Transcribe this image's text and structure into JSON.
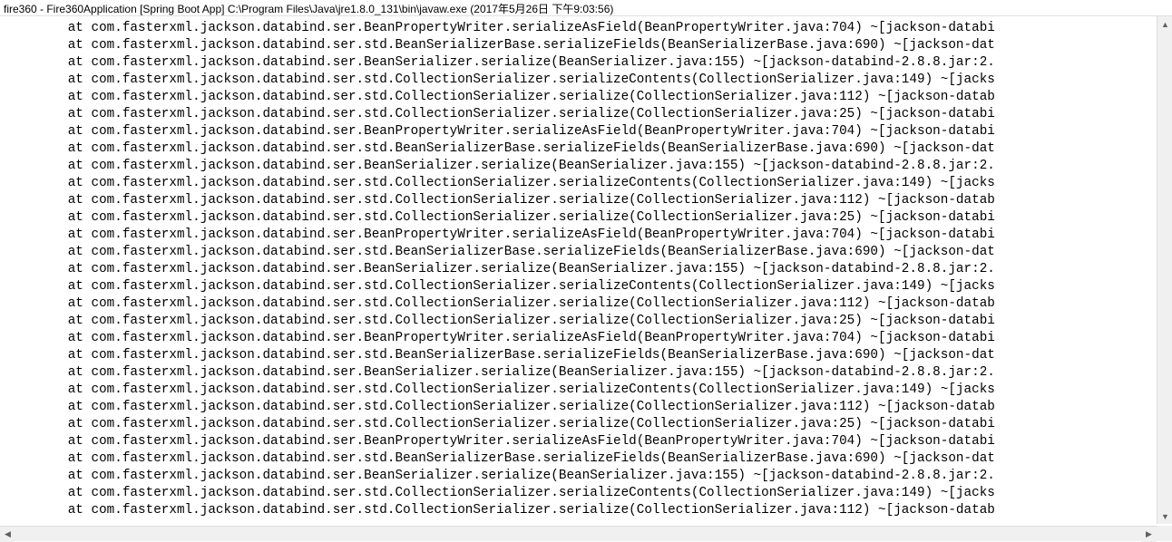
{
  "title": "fire360 - Fire360Application [Spring Boot App] C:\\Program Files\\Java\\jre1.8.0_131\\bin\\javaw.exe (2017年5月26日 下午9:03:56)",
  "console": {
    "lines": [
      "        at com.fasterxml.jackson.databind.ser.BeanPropertyWriter.serializeAsField(BeanPropertyWriter.java:704) ~[jackson-databi",
      "        at com.fasterxml.jackson.databind.ser.std.BeanSerializerBase.serializeFields(BeanSerializerBase.java:690) ~[jackson-dat",
      "        at com.fasterxml.jackson.databind.ser.BeanSerializer.serialize(BeanSerializer.java:155) ~[jackson-databind-2.8.8.jar:2.",
      "        at com.fasterxml.jackson.databind.ser.std.CollectionSerializer.serializeContents(CollectionSerializer.java:149) ~[jacks",
      "        at com.fasterxml.jackson.databind.ser.std.CollectionSerializer.serialize(CollectionSerializer.java:112) ~[jackson-datab",
      "        at com.fasterxml.jackson.databind.ser.std.CollectionSerializer.serialize(CollectionSerializer.java:25) ~[jackson-databi",
      "        at com.fasterxml.jackson.databind.ser.BeanPropertyWriter.serializeAsField(BeanPropertyWriter.java:704) ~[jackson-databi",
      "        at com.fasterxml.jackson.databind.ser.std.BeanSerializerBase.serializeFields(BeanSerializerBase.java:690) ~[jackson-dat",
      "        at com.fasterxml.jackson.databind.ser.BeanSerializer.serialize(BeanSerializer.java:155) ~[jackson-databind-2.8.8.jar:2.",
      "        at com.fasterxml.jackson.databind.ser.std.CollectionSerializer.serializeContents(CollectionSerializer.java:149) ~[jacks",
      "        at com.fasterxml.jackson.databind.ser.std.CollectionSerializer.serialize(CollectionSerializer.java:112) ~[jackson-datab",
      "        at com.fasterxml.jackson.databind.ser.std.CollectionSerializer.serialize(CollectionSerializer.java:25) ~[jackson-databi",
      "        at com.fasterxml.jackson.databind.ser.BeanPropertyWriter.serializeAsField(BeanPropertyWriter.java:704) ~[jackson-databi",
      "        at com.fasterxml.jackson.databind.ser.std.BeanSerializerBase.serializeFields(BeanSerializerBase.java:690) ~[jackson-dat",
      "        at com.fasterxml.jackson.databind.ser.BeanSerializer.serialize(BeanSerializer.java:155) ~[jackson-databind-2.8.8.jar:2.",
      "        at com.fasterxml.jackson.databind.ser.std.CollectionSerializer.serializeContents(CollectionSerializer.java:149) ~[jacks",
      "        at com.fasterxml.jackson.databind.ser.std.CollectionSerializer.serialize(CollectionSerializer.java:112) ~[jackson-datab",
      "        at com.fasterxml.jackson.databind.ser.std.CollectionSerializer.serialize(CollectionSerializer.java:25) ~[jackson-databi",
      "        at com.fasterxml.jackson.databind.ser.BeanPropertyWriter.serializeAsField(BeanPropertyWriter.java:704) ~[jackson-databi",
      "        at com.fasterxml.jackson.databind.ser.std.BeanSerializerBase.serializeFields(BeanSerializerBase.java:690) ~[jackson-dat",
      "        at com.fasterxml.jackson.databind.ser.BeanSerializer.serialize(BeanSerializer.java:155) ~[jackson-databind-2.8.8.jar:2.",
      "        at com.fasterxml.jackson.databind.ser.std.CollectionSerializer.serializeContents(CollectionSerializer.java:149) ~[jacks",
      "        at com.fasterxml.jackson.databind.ser.std.CollectionSerializer.serialize(CollectionSerializer.java:112) ~[jackson-datab",
      "        at com.fasterxml.jackson.databind.ser.std.CollectionSerializer.serialize(CollectionSerializer.java:25) ~[jackson-databi",
      "        at com.fasterxml.jackson.databind.ser.BeanPropertyWriter.serializeAsField(BeanPropertyWriter.java:704) ~[jackson-databi",
      "        at com.fasterxml.jackson.databind.ser.std.BeanSerializerBase.serializeFields(BeanSerializerBase.java:690) ~[jackson-dat",
      "        at com.fasterxml.jackson.databind.ser.BeanSerializer.serialize(BeanSerializer.java:155) ~[jackson-databind-2.8.8.jar:2.",
      "        at com.fasterxml.jackson.databind.ser.std.CollectionSerializer.serializeContents(CollectionSerializer.java:149) ~[jacks",
      "        at com.fasterxml.jackson.databind.ser.std.CollectionSerializer.serialize(CollectionSerializer.java:112) ~[jackson-datab"
    ]
  }
}
